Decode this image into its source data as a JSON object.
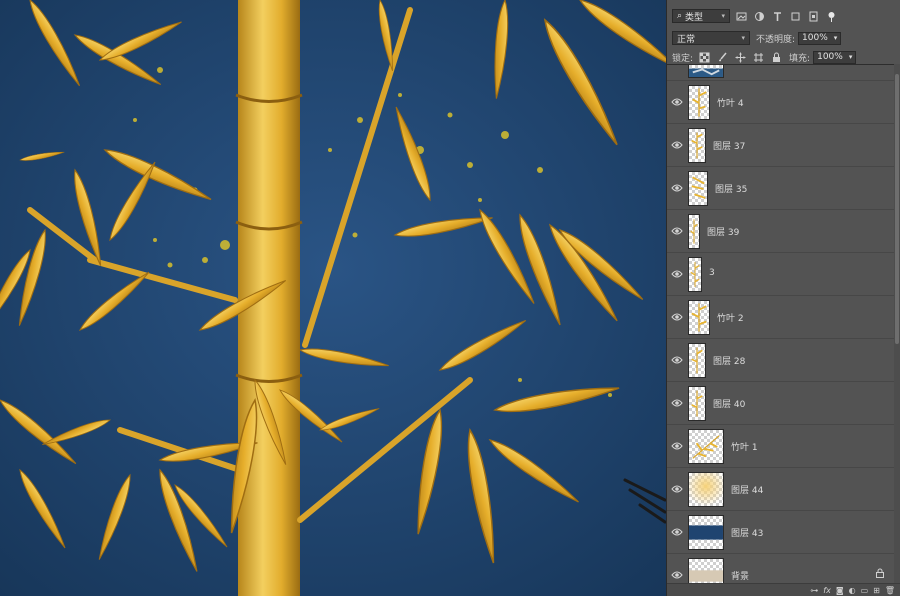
{
  "panel": {
    "filter_kind": "类型",
    "blend_mode": "正常",
    "opacity_label": "不透明度:",
    "opacity_value": "100%",
    "lock_label": "锁定:",
    "fill_label": "填充:",
    "fill_value": "100%"
  },
  "layers": [
    {
      "name": ""
    },
    {
      "name": "竹叶 4"
    },
    {
      "name": "图层 37"
    },
    {
      "name": "图层 35"
    },
    {
      "name": "图层 39"
    },
    {
      "name": "3"
    },
    {
      "name": "竹叶 2"
    },
    {
      "name": "图层 28"
    },
    {
      "name": "图层 40"
    },
    {
      "name": "竹叶 1"
    },
    {
      "name": "图层 44"
    },
    {
      "name": "图层 43"
    },
    {
      "name": "背景"
    }
  ],
  "footer_icons": [
    "link-icon",
    "fx-icon",
    "mask-icon",
    "adjustment-icon",
    "folder-icon",
    "new-layer-icon",
    "trash-icon"
  ],
  "colors": {
    "canvas_blue": "#1f4470",
    "gold": "#e8b430",
    "gold_light": "#f7d56b",
    "panel_bg": "#535353"
  }
}
